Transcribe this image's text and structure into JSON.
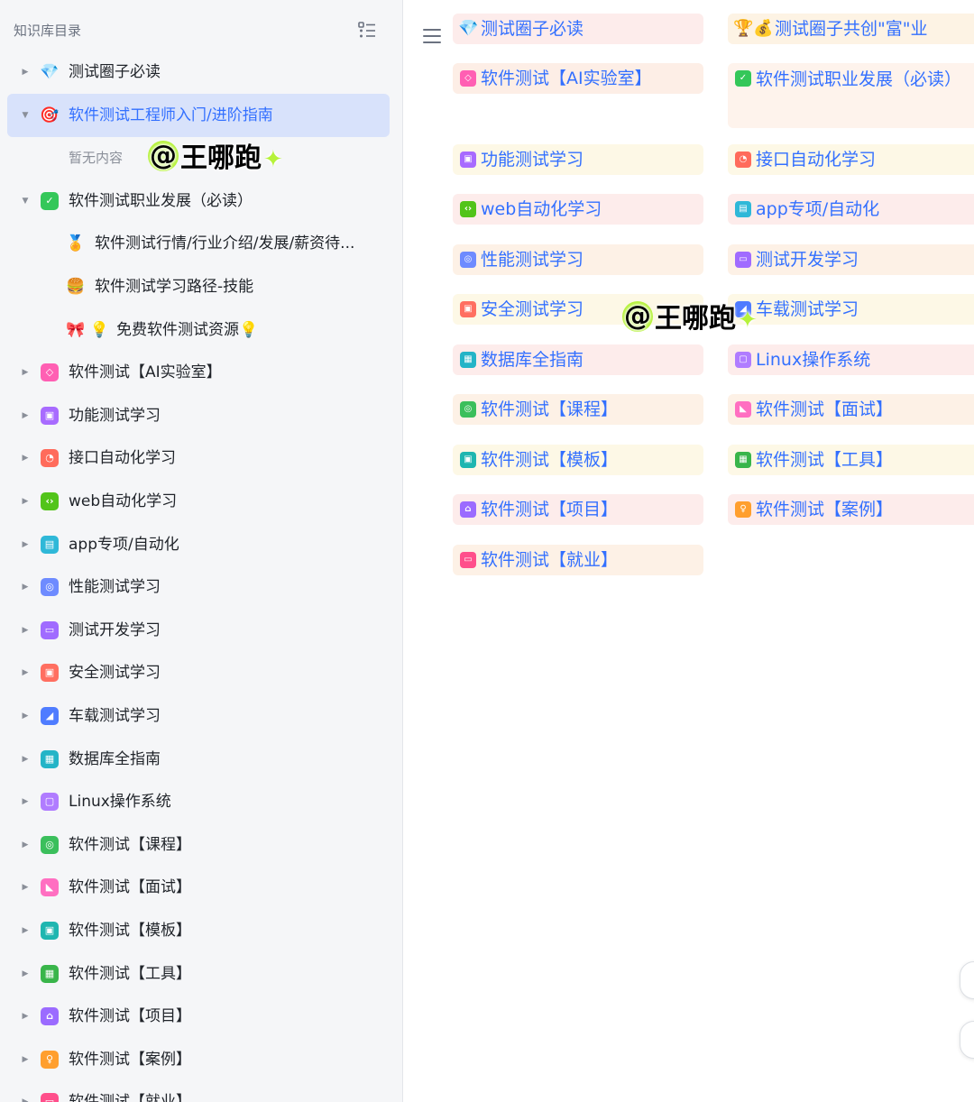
{
  "sidebar": {
    "title": "知识库目录",
    "items": [
      {
        "label": "测试圈子必读",
        "icon": "diamond-icon",
        "emoji": "💎",
        "caret": "right",
        "level": 0
      },
      {
        "label": "软件测试工程师入门/进阶指南",
        "icon": "target-icon",
        "emoji": "🎯",
        "caret": "down",
        "level": 0,
        "active": true
      },
      {
        "label": "暂无内容",
        "level": 1,
        "empty": true
      },
      {
        "label": "软件测试职业发展（必读）",
        "icon": "check-icon",
        "color": "#34c759",
        "glyph": "✓",
        "caret": "down",
        "level": 0
      },
      {
        "label": "软件测试行情/行业介绍/发展/薪资待...",
        "icon": "medal-icon",
        "emoji": "🏅",
        "level": 1
      },
      {
        "label": "软件测试学习路径-技能",
        "icon": "burger-icon",
        "emoji": "🍔",
        "level": 1
      },
      {
        "label": "免费软件测试资源💡",
        "icon": "ribbon-icon",
        "emoji": "🎀 💡",
        "level": 1
      },
      {
        "label": "软件测试【AI实验室】",
        "icon": "ai-icon",
        "color": "#ff5fb3",
        "glyph": "◇",
        "caret": "right",
        "level": 0
      },
      {
        "label": "功能测试学习",
        "icon": "function-icon",
        "color": "#a86bff",
        "glyph": "▣",
        "caret": "right",
        "level": 0
      },
      {
        "label": "接口自动化学习",
        "icon": "api-icon",
        "color": "#ff6b5b",
        "glyph": "◔",
        "caret": "right",
        "level": 0
      },
      {
        "label": "web自动化学习",
        "icon": "code-icon",
        "color": "#52c41a",
        "glyph": "‹›",
        "caret": "right",
        "level": 0
      },
      {
        "label": "app专项/自动化",
        "icon": "app-icon",
        "color": "#2fb8d8",
        "glyph": "▤",
        "caret": "right",
        "level": 0
      },
      {
        "label": "性能测试学习",
        "icon": "performance-icon",
        "color": "#6e8bff",
        "glyph": "◎",
        "caret": "right",
        "level": 0
      },
      {
        "label": "测试开发学习",
        "icon": "dev-icon",
        "color": "#a06bff",
        "glyph": "▭",
        "caret": "right",
        "level": 0
      },
      {
        "label": "安全测试学习",
        "icon": "security-icon",
        "color": "#ff6f61",
        "glyph": "▣",
        "caret": "right",
        "level": 0
      },
      {
        "label": "车载测试学习",
        "icon": "car-icon",
        "color": "#4f7cff",
        "glyph": "◢",
        "caret": "right",
        "level": 0
      },
      {
        "label": "数据库全指南",
        "icon": "database-icon",
        "color": "#24b4c7",
        "glyph": "▦",
        "caret": "right",
        "level": 0
      },
      {
        "label": "Linux操作系统",
        "icon": "linux-icon",
        "color": "#b07cff",
        "glyph": "▢",
        "caret": "right",
        "level": 0
      },
      {
        "label": "软件测试【课程】",
        "icon": "course-icon",
        "color": "#3bbf5c",
        "glyph": "◎",
        "caret": "right",
        "level": 0
      },
      {
        "label": "软件测试【面试】",
        "icon": "interview-icon",
        "color": "#ff6fc1",
        "glyph": "◣",
        "caret": "right",
        "level": 0
      },
      {
        "label": "软件测试【模板】",
        "icon": "template-icon",
        "color": "#1fb6b0",
        "glyph": "▣",
        "caret": "right",
        "level": 0
      },
      {
        "label": "软件测试【工具】",
        "icon": "tool-icon",
        "color": "#39b54a",
        "glyph": "▦",
        "caret": "right",
        "level": 0
      },
      {
        "label": "软件测试【项目】",
        "icon": "project-icon",
        "color": "#9b6bff",
        "glyph": "⌂",
        "caret": "right",
        "level": 0
      },
      {
        "label": "软件测试【案例】",
        "icon": "case-icon",
        "color": "#ff9f2e",
        "glyph": "♀",
        "caret": "right",
        "level": 0
      },
      {
        "label": "软件测试【就业】",
        "icon": "employment-icon",
        "color": "#ff4f8b",
        "glyph": "▭",
        "caret": "right",
        "level": 0
      }
    ]
  },
  "main": {
    "cards": [
      {
        "label": "测试圈子必读",
        "icon": "diamond-icon",
        "emoji": "💎",
        "bg": "#fdeceb"
      },
      {
        "label": "测试圈子共创\"富\"业",
        "icon": "money-bag-icon",
        "emoji": "🏆💰",
        "bg": "#fdf3e4",
        "suffix": "💰"
      },
      {
        "label": "软件测试【AI实验室】",
        "icon": "ai-icon",
        "color": "#ff5fb3",
        "glyph": "◇",
        "bg": "#fdeee6"
      },
      {
        "label": "软件测试职业发展（必读）",
        "icon": "check-icon",
        "color": "#34c759",
        "glyph": "✓",
        "bg": "#fef3ec",
        "tall": true
      },
      {
        "label": "功能测试学习",
        "icon": "function-icon",
        "color": "#a86bff",
        "glyph": "▣",
        "bg": "#fdf8e6"
      },
      {
        "label": "接口自动化学习",
        "icon": "api-icon",
        "color": "#ff6b5b",
        "glyph": "◔",
        "bg": "#fdf8e6"
      },
      {
        "label": "web自动化学习",
        "icon": "code-icon",
        "color": "#52c41a",
        "glyph": "‹›",
        "bg": "#fdeceb"
      },
      {
        "label": "app专项/自动化",
        "icon": "app-icon",
        "color": "#2fb8d8",
        "glyph": "▤",
        "bg": "#fdeceb"
      },
      {
        "label": "性能测试学习",
        "icon": "performance-icon",
        "color": "#6e8bff",
        "glyph": "◎",
        "bg": "#fdf1e6"
      },
      {
        "label": "测试开发学习",
        "icon": "dev-icon",
        "color": "#a06bff",
        "glyph": "▭",
        "bg": "#fdf1e6"
      },
      {
        "label": "安全测试学习",
        "icon": "security-icon",
        "color": "#ff6f61",
        "glyph": "▣",
        "bg": "#fdf8e6"
      },
      {
        "label": "车载测试学习",
        "icon": "car-icon",
        "color": "#4f7cff",
        "glyph": "◢",
        "bg": "#fdf8e6"
      },
      {
        "label": "数据库全指南",
        "icon": "database-icon",
        "color": "#24b4c7",
        "glyph": "▦",
        "bg": "#fdeceb"
      },
      {
        "label": "Linux操作系统",
        "icon": "linux-icon",
        "color": "#b07cff",
        "glyph": "▢",
        "bg": "#fdeceb"
      },
      {
        "label": "软件测试【课程】",
        "icon": "course-icon",
        "color": "#3bbf5c",
        "glyph": "◎",
        "bg": "#fdf1e6"
      },
      {
        "label": "软件测试【面试】",
        "icon": "interview-icon",
        "color": "#ff6fc1",
        "glyph": "◣",
        "bg": "#fdf1e6"
      },
      {
        "label": "软件测试【模板】",
        "icon": "template-icon",
        "color": "#1fb6b0",
        "glyph": "▣",
        "bg": "#fdf8e6"
      },
      {
        "label": "软件测试【工具】",
        "icon": "tool-icon",
        "color": "#39b54a",
        "glyph": "▦",
        "bg": "#fdf8e6"
      },
      {
        "label": "软件测试【项目】",
        "icon": "project-icon",
        "color": "#9b6bff",
        "glyph": "⌂",
        "bg": "#fdeceb"
      },
      {
        "label": "软件测试【案例】",
        "icon": "case-icon",
        "color": "#ff9f2e",
        "glyph": "♀",
        "bg": "#fdeceb"
      },
      {
        "label": "软件测试【就业】",
        "icon": "employment-icon",
        "color": "#ff4f8b",
        "glyph": "▭",
        "bg": "#fdf1e6"
      }
    ]
  },
  "watermark": {
    "text": "王哪跑",
    "at": "@",
    "spark": "✦"
  },
  "colors": {
    "accent": "#3370ff",
    "sidebar_bg": "#f5f6f8",
    "active_bg": "#d8e2fb"
  }
}
